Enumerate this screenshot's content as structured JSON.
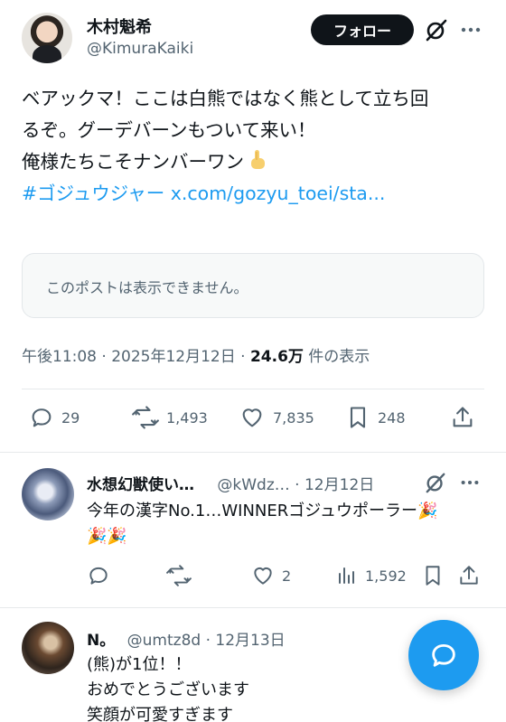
{
  "post": {
    "author_name": "木村魁希",
    "author_handle": "@KimuraKaiki",
    "follow_label": "フォロー",
    "text_lines": [
      "ベアックマ！ここは白熊ではなく熊として立ち回",
      "るぞ。グーデバーンもついて来い！"
    ],
    "line3": "俺様たちこそナンバーワン",
    "hashtag": "#ゴジュウジャー",
    "link": "x.com/gozyu_toei/sta...",
    "quote_unavailable": "このポストは表示できません。",
    "time": "午後11:08 · 2025年12月12日 · ",
    "views": "24.6万",
    "views_suffix": " 件の表示",
    "replies": "29",
    "reposts": "1,493",
    "likes": "7,835",
    "bookmarks": "248"
  },
  "replies": [
    {
      "name": "水想幻獣使い…",
      "handle": "@kWdz…",
      "date": " · 12月12日",
      "line1": "今年の漢字No.1…WINNERゴジュウポーラー🎉",
      "line2": "🎉🎉",
      "likes": "2",
      "views": "1,592"
    },
    {
      "name": "N。",
      "handle": "@umtz8d",
      "date": " · 12月13日",
      "line1": "(熊)が1位！！",
      "line2": "おめでとうございます",
      "line3": "笑顔が可愛すぎます"
    }
  ],
  "icons": {
    "grok": "grok-icon",
    "more": "more-icon",
    "reply": "reply-icon",
    "repost": "repost-icon",
    "like": "heart-icon",
    "bookmark": "bookmark-icon",
    "share": "share-icon",
    "views": "views-icon",
    "compose": "reply-compose-icon"
  },
  "colors": {
    "accent": "#1d9bf0",
    "text": "#0f1419",
    "muted": "#536471"
  }
}
